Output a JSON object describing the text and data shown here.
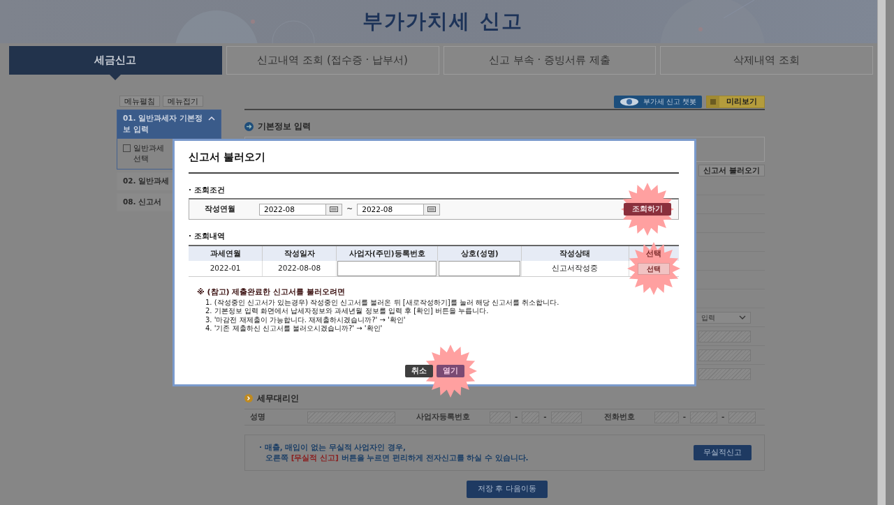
{
  "header": {
    "title": "부가가치세 신고"
  },
  "tabs": [
    {
      "label": "세금신고",
      "selected": true
    },
    {
      "label": "신고내역 조회 (접수증 · 납부서)",
      "selected": false
    },
    {
      "label": "신고 부속 · 증빙서류 제출",
      "selected": false
    },
    {
      "label": "삭제내역 조회",
      "selected": false
    }
  ],
  "sidebar": {
    "buttons": [
      "메뉴펼침",
      "메뉴접기"
    ],
    "items": [
      {
        "label": "01. 일반과세자 기본정보 입력",
        "selected": true,
        "expanded": true,
        "children": [
          {
            "lines": [
              "일반과세",
              "선택"
            ]
          }
        ]
      },
      {
        "label": "02. 일반과세",
        "selected": false,
        "expanded": false
      },
      {
        "label": "08. 신고서",
        "selected": false,
        "expanded": false
      }
    ]
  },
  "toolbar": [
    {
      "label": "부가세 신고 챗봇",
      "kind": "chatbot"
    },
    {
      "label": "미리보기",
      "kind": "preview"
    }
  ],
  "basic_info": {
    "heading": "기본정보 입력",
    "load_button": "신고서 불러오기",
    "select_value": "입력"
  },
  "agent": {
    "heading": "세무대리인",
    "name_label": "성명",
    "bizno_label": "사업자등록번호",
    "phone_label": "전화번호",
    "separator": "-"
  },
  "notice": {
    "line1": "· 매출, 매입이 없는 무실적 사업자인 경우,",
    "line2": [
      {
        "text": "오른쪽 ",
        "emphasis": false
      },
      {
        "text": "[무실적 신고]",
        "emphasis": true
      },
      {
        "text": " 버튼을 누르면 편리하게 전자신고를 하실 수 있습니다.",
        "emphasis": false
      }
    ],
    "button": "무실적신고"
  },
  "save_button": "저장 후 다음이동",
  "modal": {
    "title": "신고서 불러오기",
    "bullet": "·",
    "search": {
      "heading": "조회조건",
      "label": "작성연월",
      "from": "2022-08",
      "separator": "~",
      "to": "2022-08",
      "button": "조회하기",
      "highlighted": true
    },
    "results": {
      "heading": "조회내역",
      "columns": [
        "과세연월",
        "작성일자",
        "사업자(주민)등록번호",
        "상호(성명)",
        "작성상태",
        "선택"
      ],
      "rows": [
        {
          "cells": [
            {
              "kind": "text",
              "text": "2022-01"
            },
            {
              "kind": "text",
              "text": "2022-08-08"
            },
            {
              "kind": "input"
            },
            {
              "kind": "input"
            },
            {
              "kind": "text",
              "text": "신고서작성중"
            },
            {
              "kind": "button",
              "text": "선택",
              "highlighted": true
            }
          ]
        }
      ]
    },
    "note": {
      "title": "※ (참고) 제출완료한 신고서를 불러오려면",
      "steps": [
        "1. (작성중인 신고서가 있는경우) 작성중인 신고서를 불러온 뒤 [새로작성하기]를 눌러 해당 신고서를 취소합니다.",
        "2. 기본정보 입력 화면에서 납세자정보와 과세년월 정보를 입력 후 [확인] 버튼을 누릅니다.",
        "3. '마감전 재제출이 가능합니다. 재제출하시겠습니까?' → '확인'",
        "4. '기존 제출하신 신고서를 불러오시겠습니까?' → '확인'"
      ]
    },
    "buttons": [
      {
        "label": "취소",
        "kind": "cancel",
        "highlighted": false
      },
      {
        "label": "열기",
        "kind": "open",
        "highlighted": true
      }
    ]
  }
}
